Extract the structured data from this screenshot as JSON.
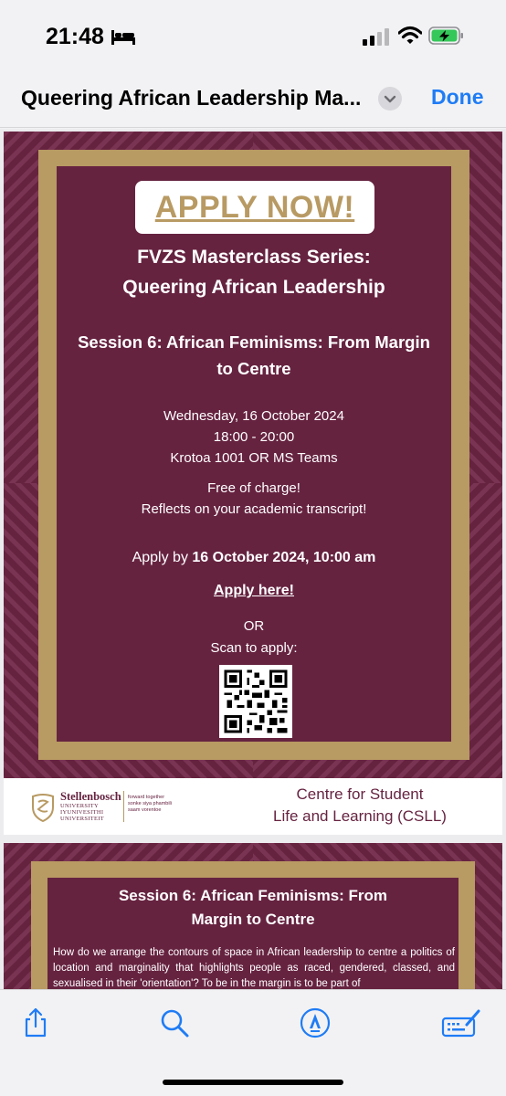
{
  "status_bar": {
    "time": "21:48",
    "sleep_icon": "bed-icon",
    "signal_icon": "cellular-signal-icon",
    "wifi_icon": "wifi-icon",
    "battery_icon": "battery-charging-icon",
    "battery_color": "#34c759"
  },
  "nav": {
    "title": "Queering African Leadership Ma...",
    "menu_icon": "chevron-down-icon",
    "done_label": "Done",
    "accent_color": "#1f7cf5"
  },
  "document": {
    "brand_color": "#662340",
    "gold_color": "#b89a63",
    "page1": {
      "apply_now": "APPLY NOW!",
      "series_line1": "FVZS Masterclass Series:",
      "series_line2": "Queering African Leadership",
      "session_line1": "Session 6: African Feminisms: From Margin",
      "session_line2": "to Centre",
      "date": "Wednesday, 16 October 2024",
      "time": "18:00 - 20:00",
      "venue": "Krotoa 1001 OR MS Teams",
      "cost": "Free of charge!",
      "transcript": "Reflects on your academic transcript!",
      "apply_by_prefix": "Apply by ",
      "apply_by_deadline": "16 October 2024, 10:00 am",
      "apply_here": "Apply here!",
      "or": "OR",
      "scan": "Scan to apply:",
      "qr_icon": "qr-code",
      "footer": {
        "university_name": "Stellenbosch",
        "university_sub1": "UNIVERSITY",
        "university_sub2": "IYUNIVESITHI",
        "university_sub3": "UNIVERSITEIT",
        "tagline1": "forward together",
        "tagline2": "sonke siya phambili",
        "tagline3": "saam vorentoe",
        "centre_line1": "Centre for Student",
        "centre_line2": "Life and Learning (CSLL)"
      }
    },
    "page2": {
      "heading_line1": "Session 6: African Feminisms: From",
      "heading_line2": "Margin to Centre",
      "paragraph": "How do we arrange the contours of space in African leadership to centre a politics of location and marginality that highlights people as raced, gendered, classed, and sexualised in their 'orientation'? To be in the margin is to be part of"
    }
  },
  "toolbar": {
    "share_icon": "share-icon",
    "search_icon": "search-icon",
    "markup_icon": "markup-pen-icon",
    "keyboard_icon": "keyboard-edit-icon"
  }
}
